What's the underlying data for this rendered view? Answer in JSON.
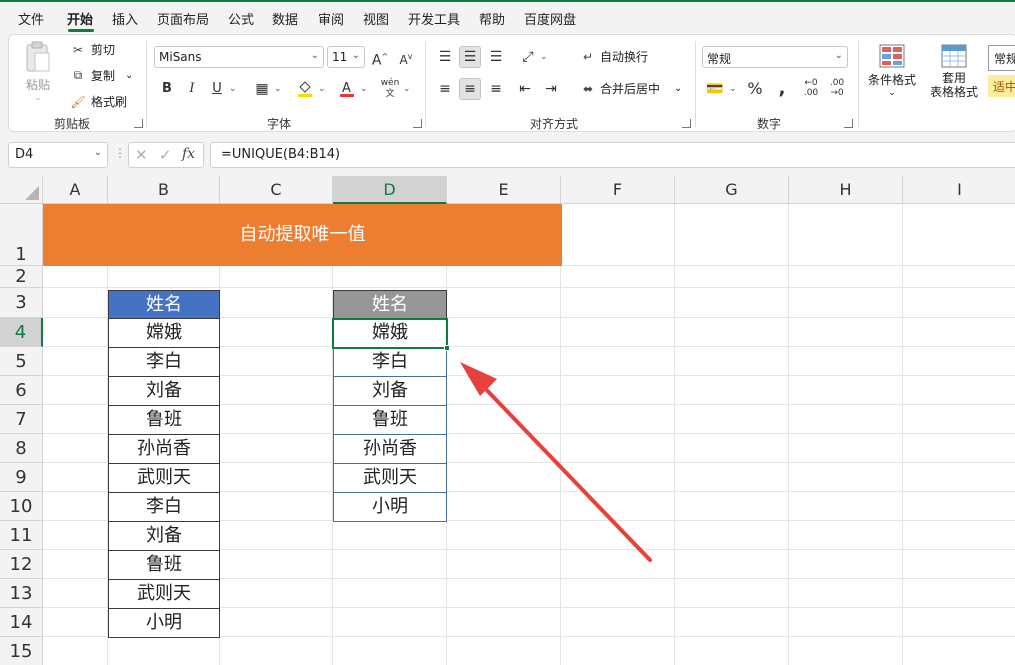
{
  "menu": [
    "文件",
    "开始",
    "插入",
    "页面布局",
    "公式",
    "数据",
    "审阅",
    "视图",
    "开发工具",
    "帮助",
    "百度网盘"
  ],
  "ribbon": {
    "clipboard": {
      "paste": "粘贴",
      "cut": "剪切",
      "copy": "复制",
      "format_painter": "格式刷",
      "label": "剪贴板"
    },
    "font": {
      "name": "MiSans",
      "size": "11",
      "label": "字体",
      "bold": "B",
      "italic": "I",
      "underline": "U"
    },
    "alignment": {
      "wrap": "自动换行",
      "merge": "合并后居中",
      "label": "对齐方式"
    },
    "number": {
      "format": "常规",
      "label": "数字"
    },
    "styles": {
      "conditional": "条件格式",
      "table_line1": "套用",
      "table_line2": "表格格式",
      "style_cut1": "常规",
      "style_cut2": "适中"
    }
  },
  "formula_bar": {
    "name_box": "D4",
    "fx": "fx",
    "formula": "=UNIQUE(B4:B14)"
  },
  "grid": {
    "columns": [
      "A",
      "B",
      "C",
      "D",
      "E",
      "F",
      "G",
      "H",
      "I"
    ],
    "rows": [
      "1",
      "2",
      "3",
      "4",
      "5",
      "6",
      "7",
      "8",
      "9",
      "10",
      "11",
      "12",
      "13",
      "14",
      "15"
    ],
    "selected_column": "D",
    "selected_row": "4"
  },
  "sheet": {
    "title": "自动提取唯一值",
    "source_header": "姓名",
    "source_values": [
      "嫦娥",
      "李白",
      "刘备",
      "鲁班",
      "孙尚香",
      "武则天",
      "李白",
      "刘备",
      "鲁班",
      "武则天",
      "小明"
    ],
    "result_header": "姓名",
    "result_values": [
      "嫦娥",
      "李白",
      "刘备",
      "鲁班",
      "孙尚香",
      "武则天",
      "小明"
    ]
  },
  "colors": {
    "accent": "#107c41",
    "banner": "#ed7d31",
    "source_header": "#4472c4",
    "result_header": "#969696",
    "arrow": "#e8403a"
  },
  "icons": [
    "paste-icon",
    "cut-icon",
    "copy-icon",
    "format-painter-icon",
    "font-grow-icon",
    "font-shrink-icon",
    "border-icon",
    "fill-color-icon",
    "font-color-icon",
    "phonetic-icon",
    "align-top-icon",
    "align-middle-icon",
    "align-bottom-icon",
    "orientation-icon",
    "wrap-text-icon",
    "align-left-icon",
    "align-center-icon",
    "align-right-icon",
    "decrease-indent-icon",
    "increase-indent-icon",
    "merge-center-icon",
    "currency-icon",
    "percent-icon",
    "comma-icon",
    "increase-decimal-icon",
    "decrease-decimal-icon",
    "conditional-format-icon",
    "format-table-icon",
    "dialog-launcher-icon",
    "cancel-icon",
    "enter-icon",
    "arrow-annotation"
  ]
}
